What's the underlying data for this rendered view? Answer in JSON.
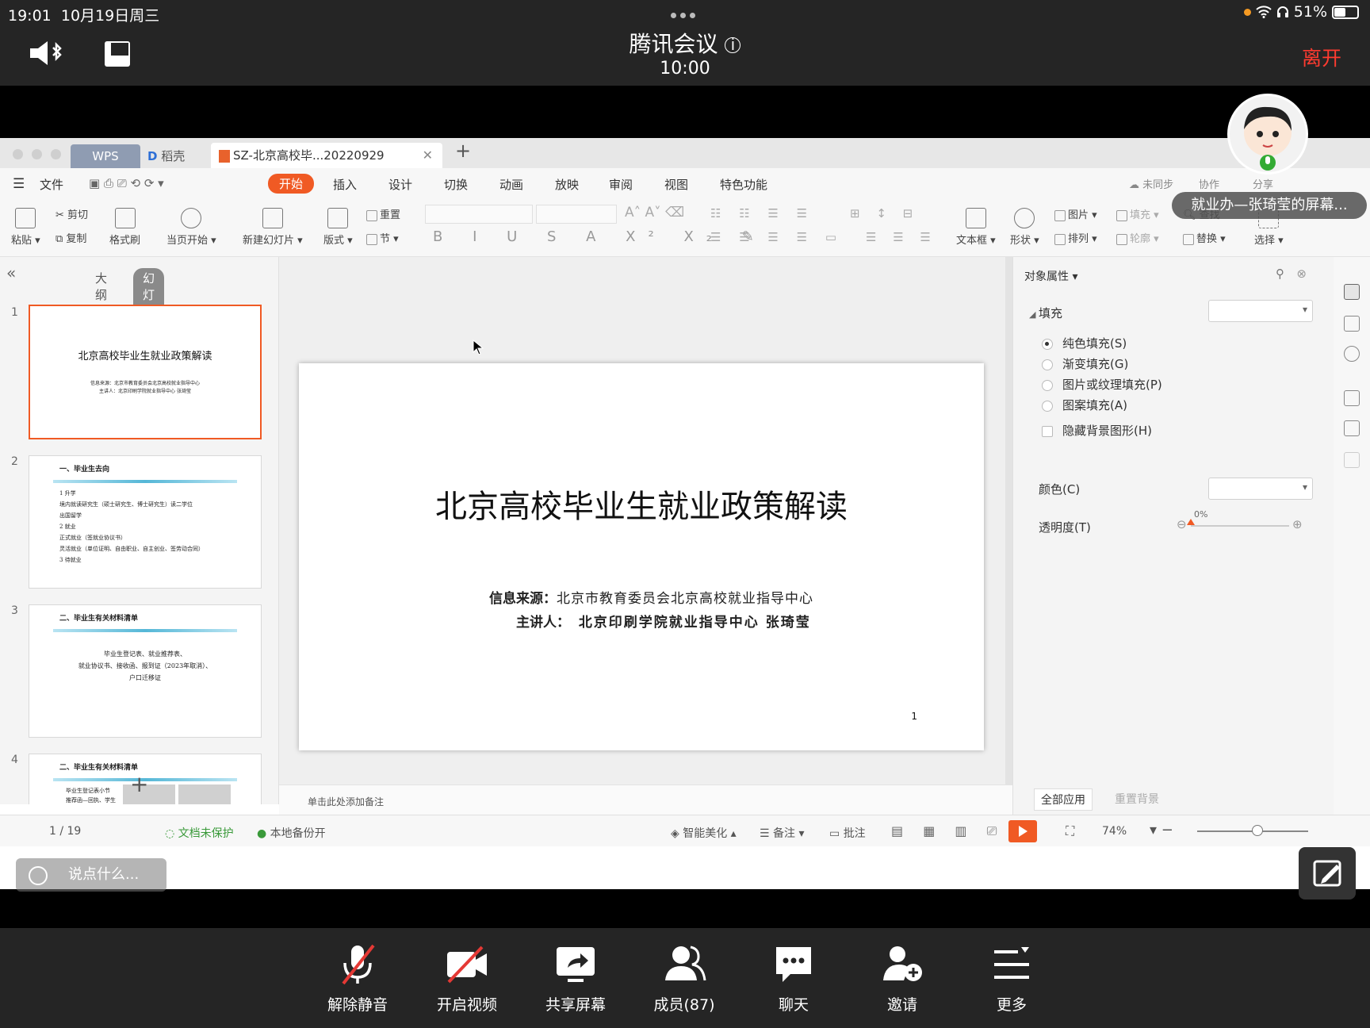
{
  "status": {
    "time": "19:01",
    "date": "10月19日周三",
    "battery": "51%",
    "battery_level": 0.51
  },
  "meeting": {
    "title": "腾讯会议",
    "duration": "10:00",
    "leave": "离开"
  },
  "wps": {
    "tabs": {
      "wps": "WPS",
      "daoke": "稻壳",
      "doc": "SZ-北京高校毕...20220929"
    },
    "menu": {
      "file": "文件",
      "start": "开始",
      "insert": "插入",
      "design": "设计",
      "transition": "切换",
      "animation": "动画",
      "slideshow": "放映",
      "review": "审阅",
      "view": "视图",
      "special": "特色功能",
      "sync": "未同步",
      "collab": "协作",
      "share": "分享"
    },
    "ribbon": {
      "paste": "粘贴",
      "cut": "剪切",
      "copy": "复制",
      "format_painter": "格式刷",
      "from_current": "当页开始",
      "new_slide": "新建幻灯片",
      "layout": "版式",
      "reset": "重置",
      "section": "节",
      "textbox": "文本框",
      "shape": "形状",
      "picture": "图片",
      "arrange": "排列",
      "fill": "填充",
      "outline": "轮廓",
      "find": "查找",
      "replace": "替换",
      "select": "选择"
    },
    "panel_tabs": {
      "outline": "大纲",
      "slides": "幻灯片"
    },
    "thumbnails": [
      {
        "num": "1",
        "title": "北京高校毕业生就业政策解读",
        "lines": [
          "信息来源：北京市教育委员会北京高校就业指导中心",
          "主讲人：北京印刷学院就业指导中心 张琦莹"
        ]
      },
      {
        "num": "2",
        "title": "一、毕业生去向",
        "lines": [
          "1 升学",
          "境内就读研究生（硕士研究生、博士研究生）读二学位",
          "出国留学",
          "2 就业",
          "正式就业（签就业协议书）",
          "灵活就业（单位证明、自由职业、自主创业、签劳动合同）",
          "3 待就业"
        ]
      },
      {
        "num": "3",
        "title": "二、毕业生有关材料清单",
        "lines": [
          "毕业生登记表、就业推荐表、",
          "就业协议书、接收函、报到证（2023年取消）、",
          "户口迁移证"
        ]
      },
      {
        "num": "4",
        "title": "二、毕业生有关材料清单",
        "lines": [
          "毕业生登记表小节",
          "推荐函—回执、学生"
        ]
      }
    ],
    "slide": {
      "title": "北京高校毕业生就业政策解读",
      "source_label": "信息来源：",
      "source_value": "北京市教育委员会北京高校就业指导中心",
      "speaker_label": "主讲人：",
      "speaker_value": "北京印刷学院就业指导中心 张琦莹",
      "page": "1"
    },
    "notes_placeholder": "单击此处添加备注",
    "props": {
      "title": "对象属性",
      "fill": "填充",
      "options": [
        "纯色填充(S)",
        "渐变填充(G)",
        "图片或纹理填充(P)",
        "图案填充(A)"
      ],
      "hide_bg": "隐藏背景图形(H)",
      "color": "颜色(C)",
      "transparency": "透明度(T)",
      "transparency_value": "0%",
      "apply_all": "全部应用",
      "reset_bg": "重置背景"
    },
    "statusbar": {
      "slide_count": "1 / 19",
      "theme": "智能美化",
      "not_protected": "文档未保护",
      "local_backup": "本地备份开",
      "notes": "备注",
      "comment": "批注",
      "zoom": "74%",
      "search": "说点什么..."
    }
  },
  "sharer_label": "就业办—张琦莹的屏幕...",
  "toolbar": {
    "unmute": "解除静音",
    "video": "开启视频",
    "share": "共享屏幕",
    "members": "成员(87)",
    "chat": "聊天",
    "invite": "邀请",
    "more": "更多"
  },
  "colors": {
    "accent": "#f05a24",
    "leave": "#ff3b30",
    "wps_tab": "#8f9cb2"
  }
}
